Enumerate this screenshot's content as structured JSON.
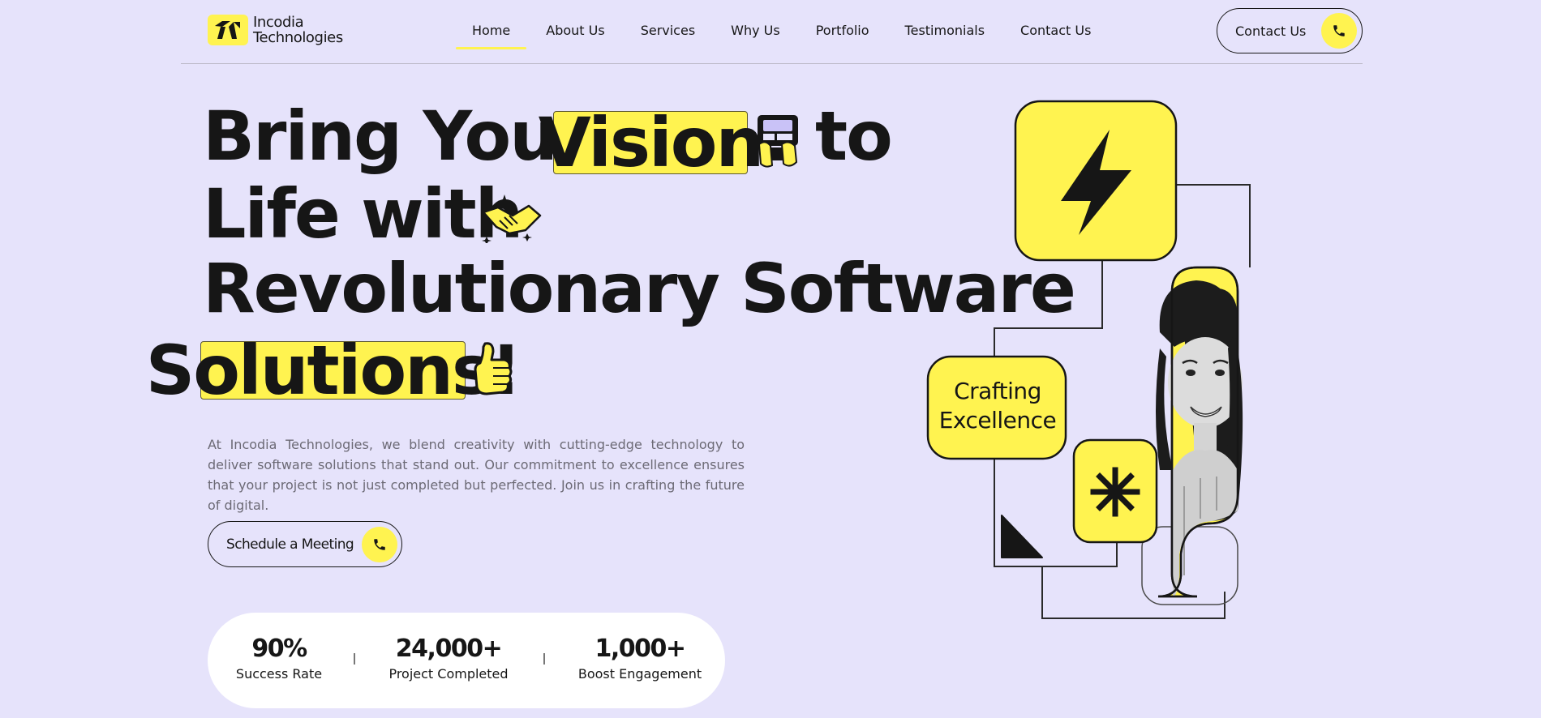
{
  "brand": {
    "name_line1": "Incodia",
    "name_line2": "Technologies",
    "accent_color": "#fff350",
    "background_color": "#e6e3fb",
    "text_color": "#161616"
  },
  "nav": {
    "items": [
      {
        "label": "Home",
        "active": true
      },
      {
        "label": "About Us",
        "active": false
      },
      {
        "label": "Services",
        "active": false
      },
      {
        "label": "Why Us",
        "active": false
      },
      {
        "label": "Portfolio",
        "active": false
      },
      {
        "label": "Testimonials",
        "active": false
      },
      {
        "label": "Contact Us",
        "active": false
      }
    ]
  },
  "header_cta": {
    "label": "Contact Us",
    "icon": "phone-icon"
  },
  "hero": {
    "line1_a": "Bring Your",
    "line1_highlight": "Vision",
    "line1_b": "to",
    "line2": "Life with",
    "line3": "Revolutionary Software",
    "line4_highlight": "Solutions!",
    "icons": [
      "laptop-icon",
      "handshake-icon",
      "thumbs-up-icon"
    ],
    "description": "At Incodia Technologies, we blend creativity with cutting-edge technology to deliver software solutions that stand out. Our commitment to excellence ensures that your project is not just completed but perfected. Join us in crafting the future of digital.",
    "cta": {
      "label": "Schedule a Meeting",
      "icon": "phone-icon"
    }
  },
  "stats": [
    {
      "value": "90%",
      "label": "Success Rate"
    },
    {
      "value": "24,000+",
      "label": "Project Completed"
    },
    {
      "value": "1,000+",
      "label": "Boost Engagement"
    }
  ],
  "illustration": {
    "caption_line1": "Crafting",
    "caption_line2": "Excellence",
    "icons": [
      "lightning-icon",
      "asterisk-icon",
      "triangle-icon",
      "woman-portrait"
    ]
  }
}
